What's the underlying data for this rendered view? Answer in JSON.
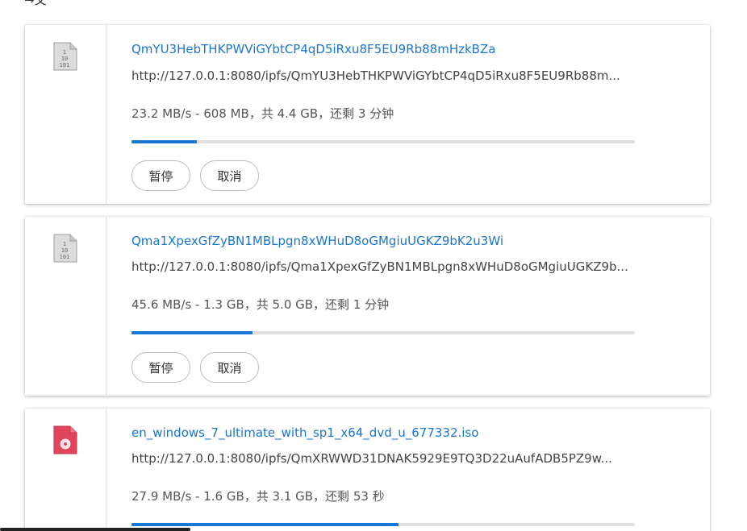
{
  "header": {
    "label": "→文"
  },
  "downloads": [
    {
      "name": "QmYU3HebTHKPWViGYbtCP4qD5iRxu8F5EU9Rb88mHzkBZa",
      "url": "http://127.0.0.1:8080/ipfs/QmYU3HebTHKPWViGYbtCP4qD5iRxu8F5EU9Rb88m...",
      "status": "23.2 MB/s - 608 MB，共 4.4 GB，还剩 3 分钟",
      "progress": 0.13,
      "icon": "binary-file-icon",
      "pause_label": "暂停",
      "cancel_label": "取消"
    },
    {
      "name": "Qma1XpexGfZyBN1MBLpgn8xWHuD8oGMgiuUGKZ9bK2u3Wi",
      "url": "http://127.0.0.1:8080/ipfs/Qma1XpexGfZyBN1MBLpgn8xWHuD8oGMgiuUGKZ9b...",
      "status": "45.6 MB/s - 1.3 GB，共 5.0 GB，还剩 1 分钟",
      "progress": 0.24,
      "icon": "binary-file-icon",
      "pause_label": "暂停",
      "cancel_label": "取消"
    },
    {
      "name": "en_windows_7_ultimate_with_sp1_x64_dvd_u_677332.iso",
      "url": "http://127.0.0.1:8080/ipfs/QmXRWWD31DNAK5929E9TQ3D22uAufADB5PZ9w...",
      "status": "27.9 MB/s - 1.6 GB，共 3.1 GB，还剩 53 秒",
      "progress": 0.53,
      "icon": "disc-image-icon",
      "pause_label": "暂停",
      "cancel_label": "取消"
    }
  ],
  "colors": {
    "accent": "#1976d2",
    "track": "#e0e0e0",
    "disc_icon": "#e0455c"
  }
}
